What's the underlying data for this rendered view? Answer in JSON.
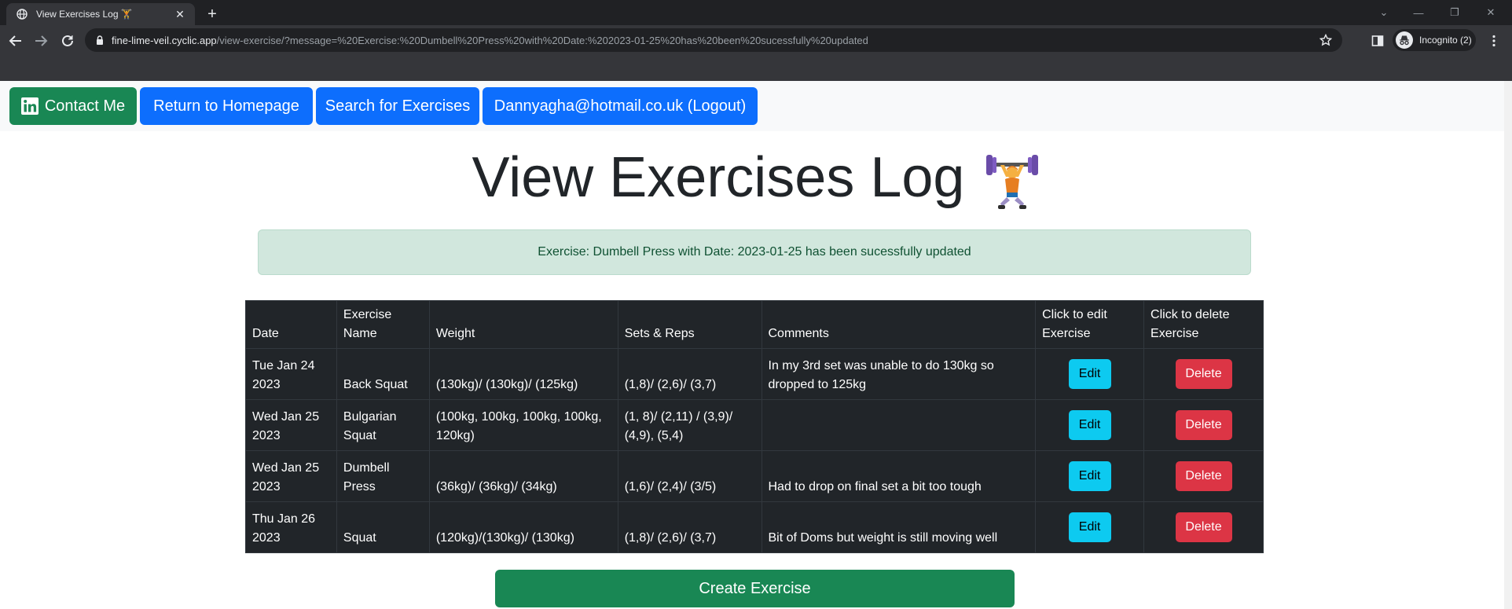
{
  "browser": {
    "tab_title": "View Exercises Log 🏋️",
    "url_host": "fine-lime-veil.cyclic.app",
    "url_path": "/view-exercise/?message=%20Exercise:%20Dumbell%20Press%20with%20Date:%202023-01-25%20has%20been%20sucessfully%20updated",
    "incognito_label": "Incognito (2)"
  },
  "nav": {
    "contact": "Contact Me",
    "home": "Return to Homepage",
    "search": "Search for Exercises",
    "logout": "Dannyagha@hotmail.co.uk (Logout)"
  },
  "page": {
    "title": "View Exercises Log",
    "alert": "Exercise: Dumbell Press with Date: 2023-01-25 has been sucessfully updated",
    "create_button": "Create Exercise"
  },
  "table": {
    "headers": [
      "Date",
      "Exercise Name",
      "Weight",
      "Sets & Reps",
      "Comments",
      "Click to edit Exercise",
      "Click to delete Exercise"
    ],
    "edit_label": "Edit",
    "delete_label": "Delete",
    "rows": [
      {
        "date": "Tue Jan 24 2023",
        "name": "Back Squat",
        "weight": "(130kg)/ (130kg)/ (125kg)",
        "sets": "(1,8)/ (2,6)/ (3,7)",
        "comments": "In my 3rd set was unable to do 130kg so dropped to 125kg"
      },
      {
        "date": "Wed Jan 25 2023",
        "name": "Bulgarian Squat",
        "weight": "(100kg, 100kg, 100kg, 100kg, 120kg)",
        "sets": "(1, 8)/ (2,11) / (3,9)/ (4,9), (5,4)",
        "comments": ""
      },
      {
        "date": "Wed Jan 25 2023",
        "name": "Dumbell Press",
        "weight": "(36kg)/ (36kg)/ (34kg)",
        "sets": "(1,6)/ (2,4)/ (3/5)",
        "comments": "Had to drop on final set a bit too tough"
      },
      {
        "date": "Thu Jan 26 2023",
        "name": "Squat",
        "weight": "(120kg)/(130kg)/ (130kg)",
        "sets": "(1,8)/ (2,6)/ (3,7)",
        "comments": "Bit of Doms but weight is still moving well"
      }
    ]
  },
  "icons": {
    "favicon": "globe-icon",
    "linkedin": "linkedin-icon",
    "lifter": "weightlifter-emoji"
  }
}
